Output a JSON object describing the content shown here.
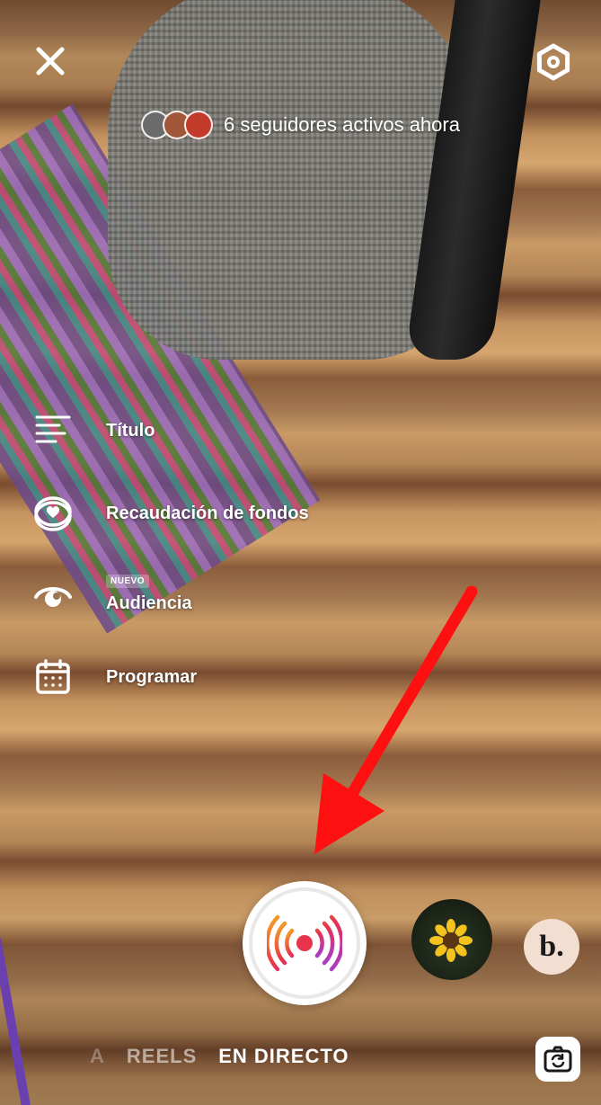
{
  "header": {
    "close_icon": "close-icon",
    "settings_icon": "gear-icon",
    "viewers_text": "6 seguidores activos ahora"
  },
  "tools_menu": {
    "items": [
      {
        "icon": "text-lines-icon",
        "label": "Título"
      },
      {
        "icon": "heart-coin-icon",
        "label": "Recaudación de fondos"
      },
      {
        "icon": "audience-eye-icon",
        "label": "Audiencia",
        "badge": "NUEVO"
      },
      {
        "icon": "calendar-icon",
        "label": "Programar"
      }
    ]
  },
  "capture": {
    "button_icon": "live-broadcast-icon",
    "effects": [
      {
        "icon": "sunflower-effect"
      },
      {
        "label": "b."
      }
    ]
  },
  "mode_bar": {
    "partial": "A",
    "modes": [
      "REELS",
      "EN DIRECTO"
    ],
    "active": "EN DIRECTO",
    "flip_icon": "flip-camera-icon"
  },
  "annotation": {
    "color": "#ff0000"
  },
  "colors": {
    "live_red": "#e8334a",
    "live_orange": "#f5a623",
    "live_purple": "#a23bd6"
  }
}
